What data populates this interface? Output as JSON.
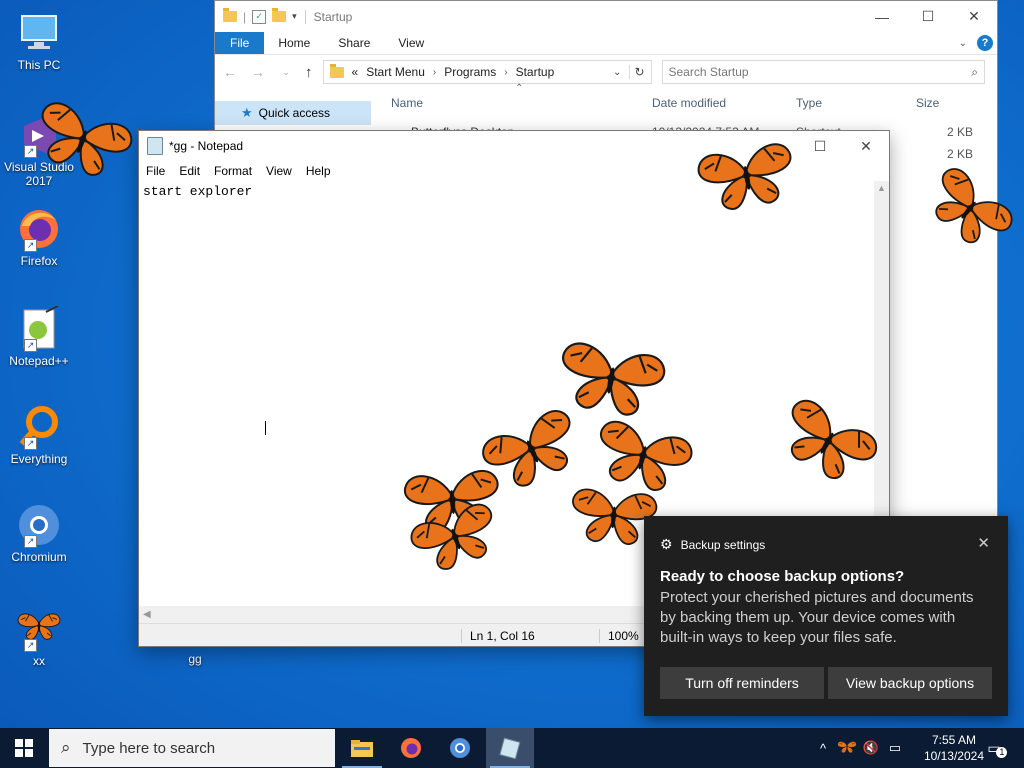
{
  "desktop": {
    "icons": [
      {
        "label": "This PC"
      },
      {
        "label": "Visual Studio 2017"
      },
      {
        "label": "Firefox"
      },
      {
        "label": "Notepad++"
      },
      {
        "label": "Everything"
      },
      {
        "label": "Chromium"
      },
      {
        "label": "xx"
      },
      {
        "label": "gg"
      }
    ]
  },
  "explorer": {
    "title": "Startup",
    "ribbon_tabs": [
      "File",
      "Home",
      "Share",
      "View"
    ],
    "breadcrumb": [
      "«",
      "Start Menu",
      "Programs",
      "Startup"
    ],
    "search_placeholder": "Search Startup",
    "nav": {
      "quick_access": "Quick access"
    },
    "columns": {
      "name": "Name",
      "date": "Date modified",
      "type": "Type",
      "size": "Size"
    },
    "rows": [
      {
        "name": "Butterflyss Desktop",
        "date": "10/13/2024 7:53 AM",
        "type": "Shortcut",
        "size": "2 KB"
      },
      {
        "name": "",
        "date": "",
        "type": "",
        "size": "2 KB"
      }
    ]
  },
  "notepad": {
    "title": "*gg - Notepad",
    "menu": [
      "File",
      "Edit",
      "Format",
      "View",
      "Help"
    ],
    "content": "start explorer",
    "status": {
      "position": "Ln 1, Col 16",
      "zoom": "100%"
    }
  },
  "toast": {
    "app": "Backup settings",
    "heading": "Ready to choose backup options?",
    "body": "Protect your cherished pictures and documents by backing them up. Your device comes with built-in ways to keep your files safe.",
    "button_left": "Turn off reminders",
    "button_right": "View backup options"
  },
  "taskbar": {
    "search_placeholder": "Type here to search",
    "time": "7:55 AM",
    "date": "10/13/2024",
    "notification_count": "1"
  },
  "colors": {
    "accent": "#1979ca",
    "butterfly": "#e8731a",
    "toast_bg": "#1f1f1f",
    "taskbar": "#0b1b33"
  }
}
